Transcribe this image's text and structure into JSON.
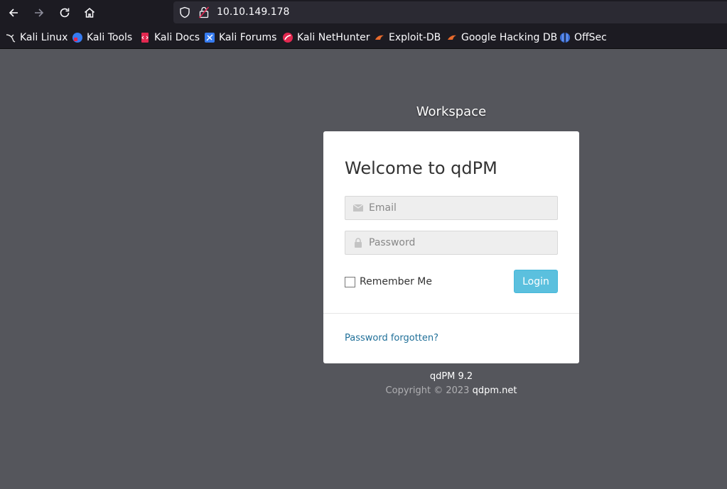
{
  "browser": {
    "url": "10.10.149.178",
    "bookmarks": [
      {
        "label": "Kali Linux",
        "icon": "kali-dragon-icon"
      },
      {
        "label": "Kali Tools",
        "icon": "kali-tools-icon"
      },
      {
        "label": "Kali Docs",
        "icon": "kali-docs-icon"
      },
      {
        "label": "Kali Forums",
        "icon": "kali-forums-icon"
      },
      {
        "label": "Kali NetHunter",
        "icon": "kali-nethunter-icon"
      },
      {
        "label": "Exploit-DB",
        "icon": "exploit-db-icon"
      },
      {
        "label": "Google Hacking DB",
        "icon": "ghdb-icon"
      },
      {
        "label": "OffSec",
        "icon": "offsec-icon"
      }
    ]
  },
  "page": {
    "workspace_title": "Workspace",
    "heading": "Welcome to qdPM",
    "email_placeholder": "Email",
    "password_placeholder": "Password",
    "remember_label": "Remember Me",
    "login_label": "Login",
    "forgot_label": "Password forgotten?",
    "version": "qdPM 9.2",
    "copyright": "Copyright © 2023",
    "site_link": "qdpm.net"
  },
  "colors": {
    "background": "#55565c",
    "login_button": "#5bc0de",
    "link": "#1f6f98"
  }
}
